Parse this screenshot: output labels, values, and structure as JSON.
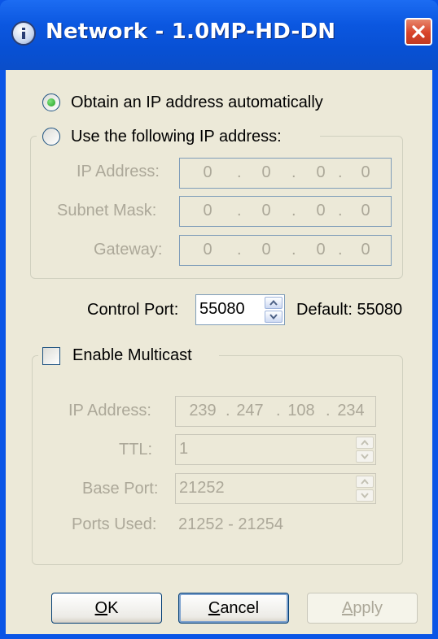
{
  "window": {
    "title": "Network - 1.0MP-HD-DN",
    "title_icon": "info-globe-icon",
    "close_icon": "close-icon"
  },
  "ip_mode": {
    "auto_label": "Obtain an IP address automatically",
    "manual_label": "Use the following IP address:",
    "selected": "auto"
  },
  "static_ip": {
    "ip_label": "IP Address:",
    "subnet_label": "Subnet Mask:",
    "gateway_label": "Gateway:",
    "ip": [
      "0",
      "0",
      "0",
      "0"
    ],
    "subnet": [
      "0",
      "0",
      "0",
      "0"
    ],
    "gateway": [
      "0",
      "0",
      "0",
      "0"
    ],
    "separator": "."
  },
  "control_port": {
    "label": "Control Port:",
    "value": "55080",
    "default_text": "Default: 55080"
  },
  "multicast": {
    "enable_label": "Enable Multicast",
    "checked": false,
    "ip_label": "IP Address:",
    "ip": [
      "239",
      "247",
      "108",
      "234"
    ],
    "separator": ".",
    "ttl_label": "TTL:",
    "ttl_value": "1",
    "base_port_label": "Base Port:",
    "base_port_value": "21252",
    "ports_used_label": "Ports Used:",
    "ports_used_value": "21252 - 21254"
  },
  "buttons": {
    "ok_mnemonic": "O",
    "ok_rest": "K",
    "cancel_mnemonic": "C",
    "cancel_rest": "ancel",
    "apply_mnemonic": "A",
    "apply_rest": "pply"
  },
  "colors": {
    "title_bar": "#0a55e6",
    "dialog_face": "#ece9d8",
    "disabled_text": "#aca899",
    "radio_selected": "#21a121",
    "close_button": "#d8432a"
  }
}
